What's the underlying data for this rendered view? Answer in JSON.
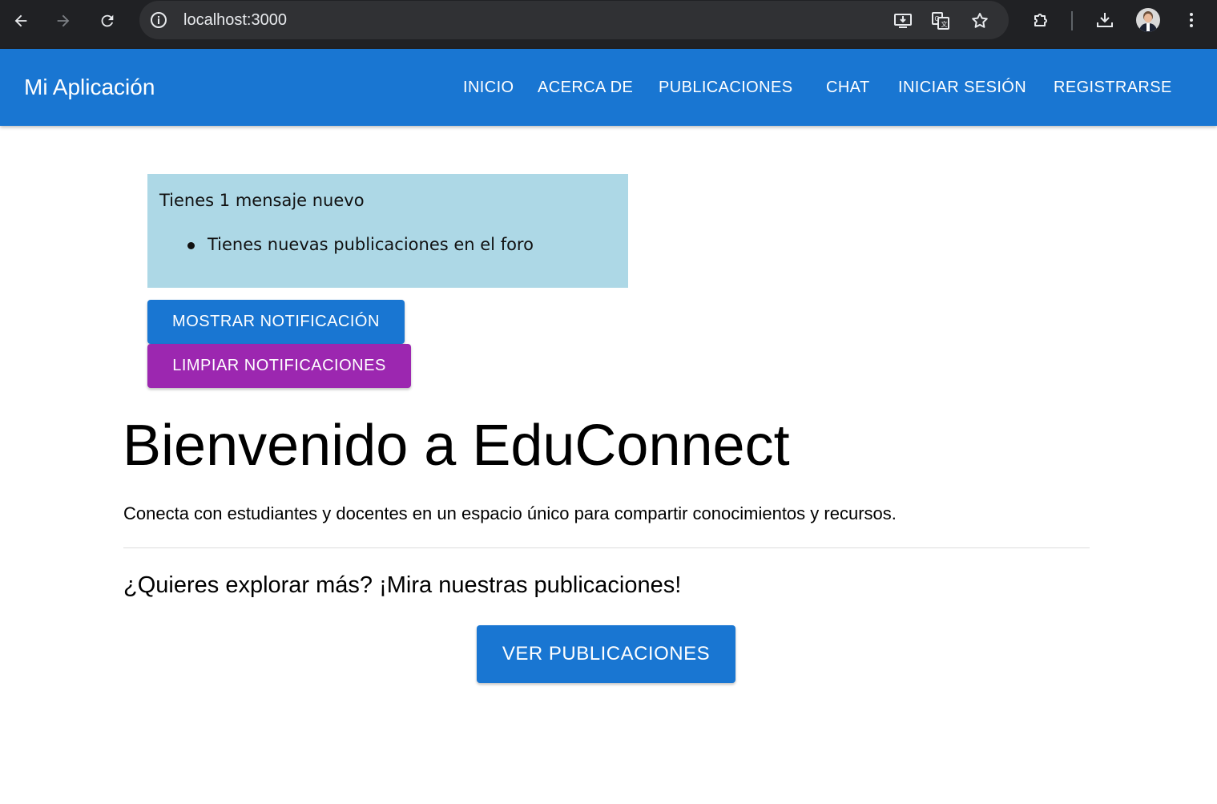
{
  "browser": {
    "url": "localhost:3000"
  },
  "appbar": {
    "brand": "Mi Aplicación",
    "nav": [
      "INICIO",
      "ACERCA DE",
      "PUBLICACIONES",
      "CHAT",
      "INICIAR SESIÓN",
      "REGISTRARSE"
    ]
  },
  "notification": {
    "message": "Tienes 1 mensaje nuevo",
    "items": [
      "Tienes nuevas publicaciones en el foro"
    ],
    "show_button": "MOSTRAR NOTIFICACIÓN",
    "clear_button": "LIMPIAR NOTIFICACIONES"
  },
  "hero": {
    "title": "Bienvenido a EduConnect",
    "subtitle": "Conecta con estudiantes y docentes en un espacio único para compartir conocimientos y recursos.",
    "explore_text": "¿Quieres explorar más? ¡Mira nuestras publicaciones!",
    "cta_button": "VER PUBLICACIONES"
  },
  "colors": {
    "primary": "#1976d2",
    "secondary": "#9c27b0",
    "notification_bg": "#add8e6"
  }
}
